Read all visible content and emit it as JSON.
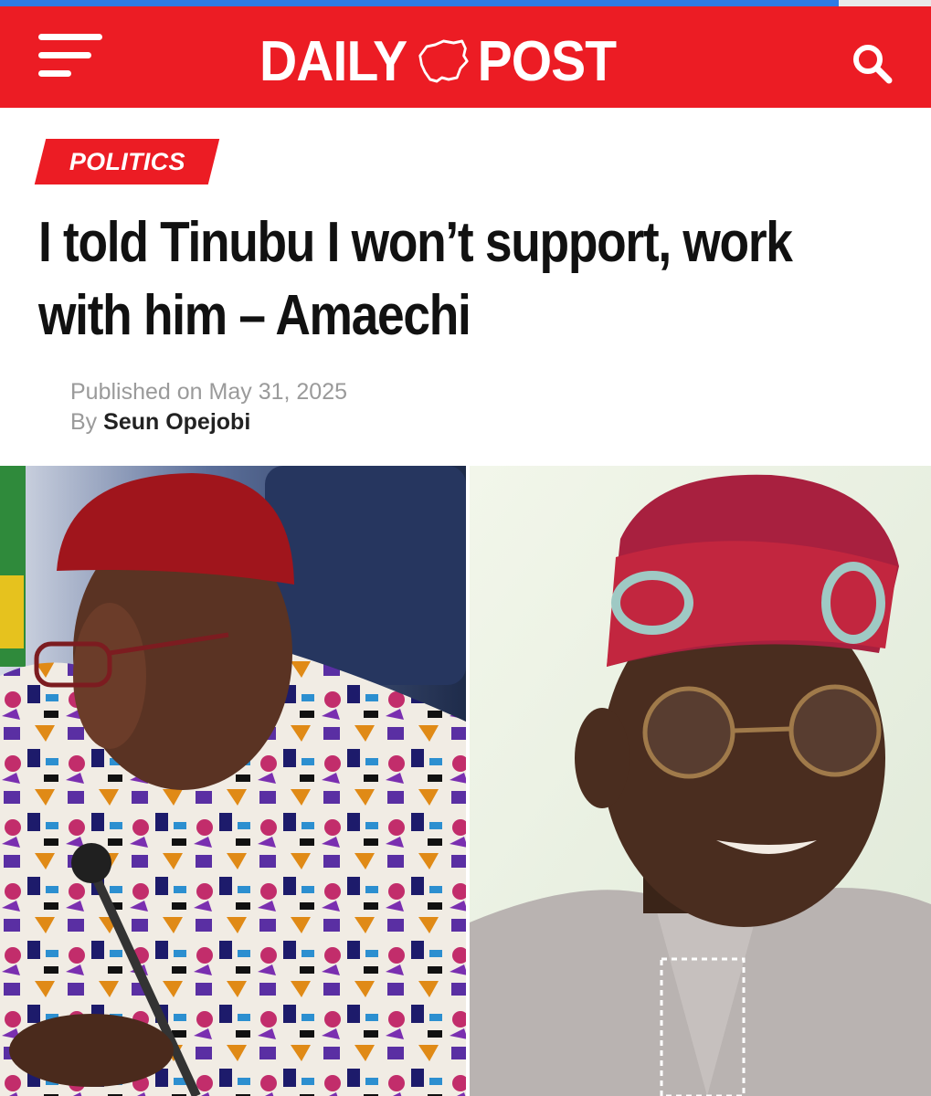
{
  "site": {
    "logo_left": "DAILY",
    "logo_right": "POST",
    "brand_color": "#ec1c24",
    "accent_color": "#2d7be5"
  },
  "header": {
    "menu_icon": "hamburger-menu-icon",
    "search_icon": "search-icon"
  },
  "article": {
    "category": "POLITICS",
    "headline": "I told Tinubu I won’t support, work with him – Amaechi",
    "published_label": "Published on",
    "published_date": "May 31, 2025",
    "by_label": "By",
    "author": "Seun Opejobi"
  }
}
